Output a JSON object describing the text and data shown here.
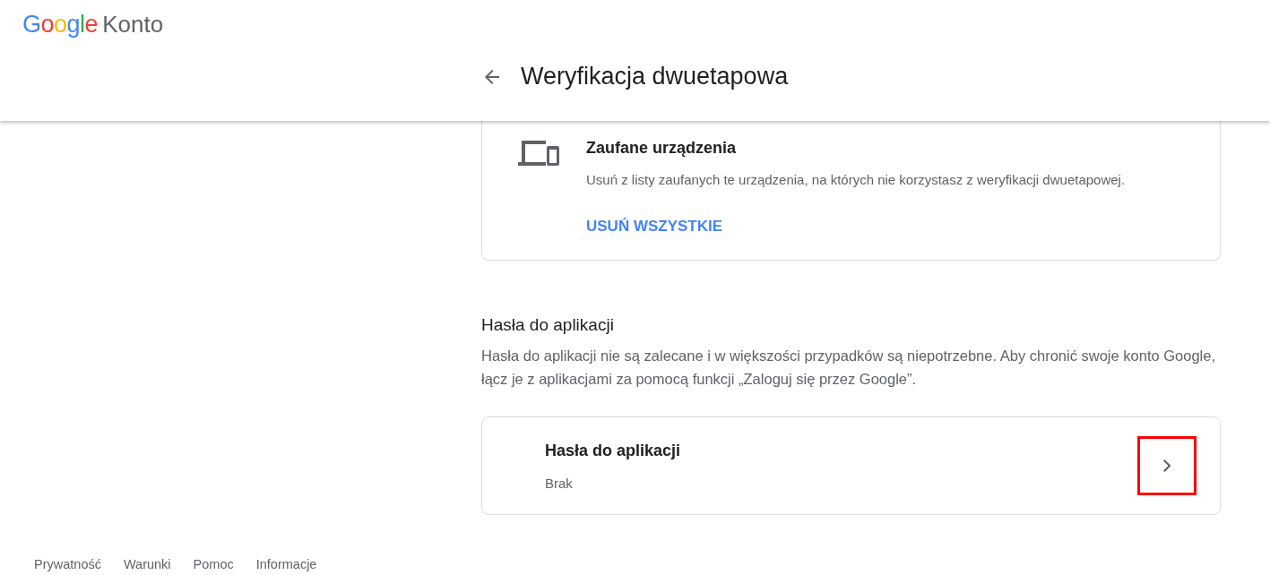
{
  "header": {
    "logo": "Google",
    "product": "Konto",
    "page_title": "Weryfikacja dwuetapowa"
  },
  "trusted_devices": {
    "title": "Zaufane urządzenia",
    "description": "Usuń z listy zaufanych te urządzenia, na których nie korzystasz z weryfikacji dwuetapowej.",
    "action": "USUŃ WSZYSTKIE"
  },
  "app_passwords": {
    "heading": "Hasła do aplikacji",
    "description": "Hasła do aplikacji nie są zalecane i w większości przypadków są niepotrzebne. Aby chronić swoje konto Google, łącz je z aplikacjami za pomocą funkcji „Zaloguj się przez Google”.",
    "card": {
      "title": "Hasła do aplikacji",
      "value": "Brak",
      "highlighted": true
    }
  },
  "footer": {
    "links": [
      "Prywatność",
      "Warunki",
      "Pomoc",
      "Informacje"
    ]
  }
}
